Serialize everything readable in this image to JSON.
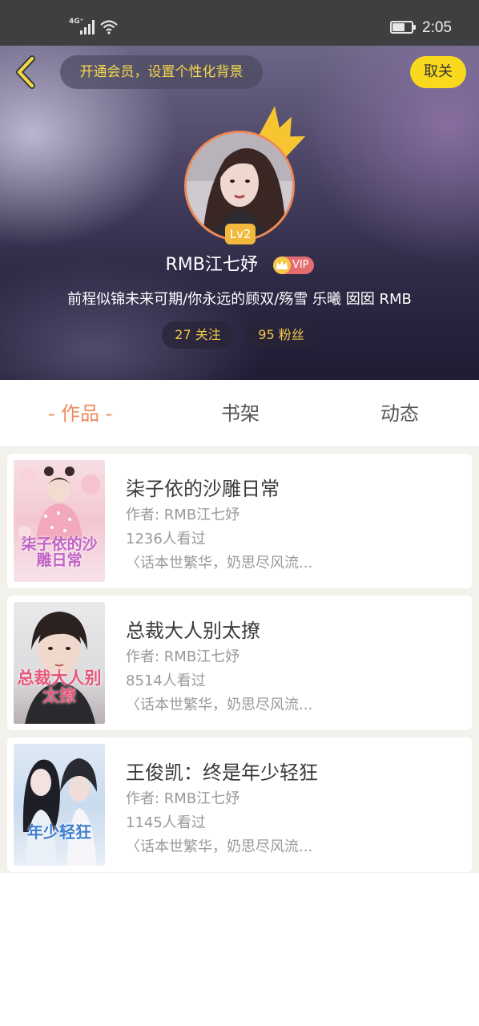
{
  "status_bar": {
    "network": "4G⁺",
    "time": "2:05"
  },
  "header": {
    "vip_banner": "开通会员，设置个性化背景",
    "follow_button": "取关",
    "level": "Lv2",
    "username": "RMB江七妤",
    "vip_label": "VIP",
    "signature": "前程似锦未来可期/你永远的顾双/殇雪 乐曦 囡囡 RMB",
    "following": "27 关注",
    "fans": "95 粉丝"
  },
  "tabs": [
    {
      "label": "- 作品 -",
      "active": true
    },
    {
      "label": "书架",
      "active": false
    },
    {
      "label": "动态",
      "active": false
    }
  ],
  "books": [
    {
      "title": "柒子依的沙雕日常",
      "author": "作者: RMB江七妤",
      "views": "1236人看过",
      "desc": "〈话本世繁华，奶思尽风流...",
      "cover_text": "柒子依的沙雕日常"
    },
    {
      "title": "总裁大人别太撩",
      "author": "作者: RMB江七妤",
      "views": "8514人看过",
      "desc": "〈话本世繁华，奶思尽风流...",
      "cover_text": "总裁大人别太撩"
    },
    {
      "title": "王俊凯：终是年少轻狂",
      "author": "作者: RMB江七妤",
      "views": "1145人看过",
      "desc": "〈话本世繁华，奶思尽风流...",
      "cover_text": "年少轻狂"
    }
  ],
  "colors": {
    "accent_orange": "#ec8b5c",
    "vip_yellow": "#f9d91d",
    "stat_yellow": "#f5c84a",
    "level_badge": "#f3b93c"
  },
  "icons": {
    "back": "chevron-left-icon",
    "crown": "crown-icon",
    "vip": "crown-badge-icon"
  }
}
